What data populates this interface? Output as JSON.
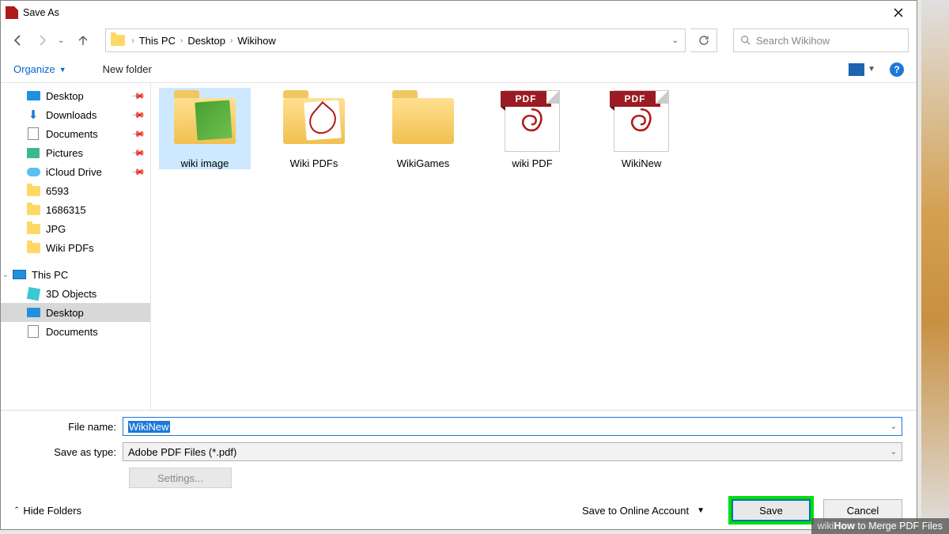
{
  "title": "Save As",
  "breadcrumb": [
    "This PC",
    "Desktop",
    "Wikihow"
  ],
  "search_placeholder": "Search Wikihow",
  "toolbar": {
    "organize": "Organize",
    "newfolder": "New folder"
  },
  "sidebar": {
    "quick": [
      {
        "label": "Desktop",
        "icon": "desktop",
        "pinned": true
      },
      {
        "label": "Downloads",
        "icon": "dl",
        "pinned": true
      },
      {
        "label": "Documents",
        "icon": "doc",
        "pinned": true
      },
      {
        "label": "Pictures",
        "icon": "pic",
        "pinned": true
      },
      {
        "label": "iCloud Drive",
        "icon": "cloud",
        "pinned": true
      },
      {
        "label": "6593",
        "icon": "folder"
      },
      {
        "label": "1686315",
        "icon": "folder"
      },
      {
        "label": "JPG",
        "icon": "folder"
      },
      {
        "label": "Wiki PDFs",
        "icon": "folder"
      }
    ],
    "thispc_label": "This PC",
    "thispc": [
      {
        "label": "3D Objects",
        "icon": "3d"
      },
      {
        "label": "Desktop",
        "icon": "desktop",
        "selected": true
      },
      {
        "label": "Documents",
        "icon": "doc"
      }
    ]
  },
  "items": [
    {
      "label": "wiki image",
      "type": "folder-green",
      "selected": true
    },
    {
      "label": "Wiki PDFs",
      "type": "folder-pdf"
    },
    {
      "label": "WikiGames",
      "type": "folder"
    },
    {
      "label": "wiki PDF",
      "type": "pdf",
      "badge": "PDF"
    },
    {
      "label": "WikiNew",
      "type": "pdf",
      "badge": "PDF"
    }
  ],
  "filename_label": "File name:",
  "filename_value": "WikiNew",
  "type_label": "Save as type:",
  "type_value": "Adobe PDF Files (*.pdf)",
  "settings_label": "Settings...",
  "hide_folders": "Hide Folders",
  "save_online": "Save to Online Account",
  "save_label": "Save",
  "cancel_label": "Cancel",
  "watermark": {
    "brand1": "wiki",
    "brand2": "How",
    "tail": " to Merge PDF Files"
  }
}
